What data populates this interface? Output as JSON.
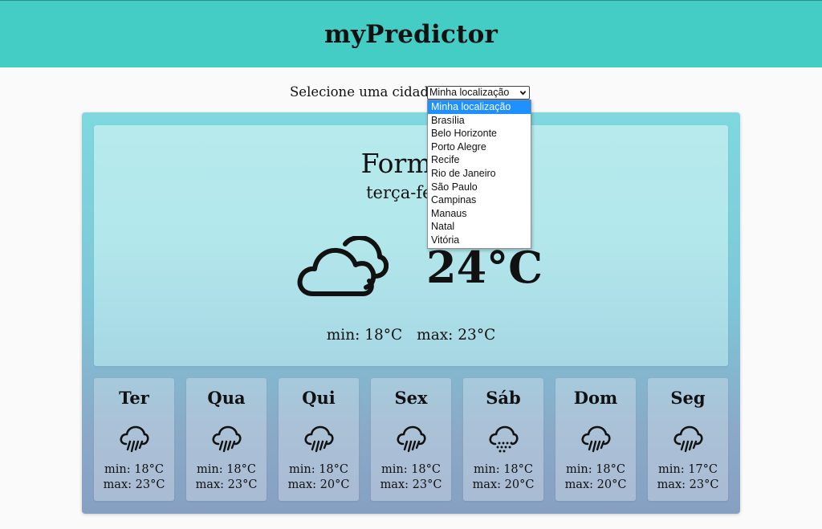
{
  "header": {
    "title": "myPredictor"
  },
  "city_picker": {
    "label": "Selecione uma cidade:",
    "selected": "Minha localização",
    "options": [
      "Minha localização",
      "Brasília",
      "Belo Horizonte",
      "Porto Alegre",
      "Recife",
      "Rio de Janeiro",
      "São Paulo",
      "Campinas",
      "Manaus",
      "Natal",
      "Vitória"
    ]
  },
  "today": {
    "city": "Formos",
    "day": "terça-feira",
    "icon": "cloud-icon",
    "temperature": "24°C",
    "min": "min: 18°C",
    "max": "max: 23°C"
  },
  "forecast": [
    {
      "day": "Ter",
      "icon": "rain-icon",
      "min": "min: 18°C",
      "max": "max: 23°C"
    },
    {
      "day": "Qua",
      "icon": "rain-icon",
      "min": "min: 18°C",
      "max": "max: 23°C"
    },
    {
      "day": "Qui",
      "icon": "rain-icon",
      "min": "min: 18°C",
      "max": "max: 20°C"
    },
    {
      "day": "Sex",
      "icon": "rain-icon",
      "min": "min: 18°C",
      "max": "max: 23°C"
    },
    {
      "day": "Sáb",
      "icon": "drizzle-icon",
      "min": "min: 18°C",
      "max": "max: 20°C"
    },
    {
      "day": "Dom",
      "icon": "rain-icon",
      "min": "min: 18°C",
      "max": "max: 20°C"
    },
    {
      "day": "Seg",
      "icon": "rain-icon",
      "min": "min: 17°C",
      "max": "max: 23°C"
    }
  ],
  "colors": {
    "header_bg": "#44cdc5",
    "selected_option_bg": "#1e90ff"
  }
}
